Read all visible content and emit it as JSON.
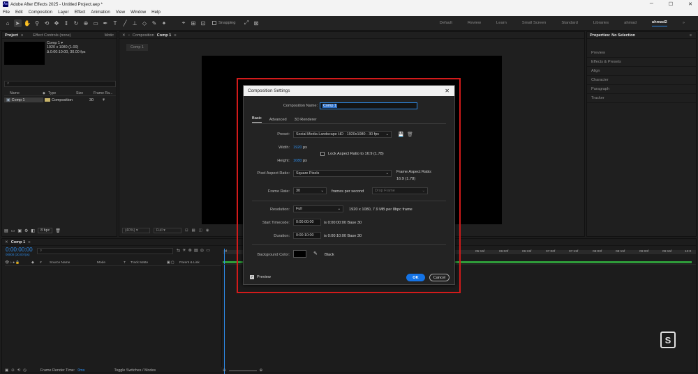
{
  "window": {
    "app_logo": "Ae",
    "title": "Adobe After Effects 2025 - Untitled Project.aep *",
    "controls": [
      "─",
      "☐",
      "✕"
    ]
  },
  "menu": [
    "File",
    "Edit",
    "Composition",
    "Layer",
    "Effect",
    "Animation",
    "View",
    "Window",
    "Help"
  ],
  "toolbar": {
    "snapping_label": "Snapping",
    "workspaces": [
      "Default",
      "Review",
      "Learn",
      "Small Screen",
      "Standard",
      "Libraries",
      "ahmad",
      "ahmad2"
    ],
    "active_workspace": "ahmad2",
    "more": "»"
  },
  "project_panel": {
    "tab_project": "Project",
    "tab_effect_controls": "Effect Controls (none)",
    "tab_more": "Motic",
    "comp_name": "Comp 1",
    "comp_dims": "1920 x 1080 (1.00)",
    "comp_duration": "Δ 0:00:10:00, 30.00 fps",
    "search_placeholder": "⌕",
    "columns": [
      "Name",
      "Type",
      "Size",
      "Frame Ra..."
    ],
    "items": [
      {
        "name": "Comp 1",
        "type": "Composition",
        "frame_rate": "30"
      }
    ],
    "bpc": "8 bpc"
  },
  "comp_viewer": {
    "tab_label": "Composition",
    "tab_name": "Comp 1",
    "sub_tab": "Comp 1",
    "zoom": "(40%)",
    "quality": "Full"
  },
  "right_panel": {
    "title": "Properties: No Selection",
    "items": [
      "Preview",
      "Effects & Presets",
      "Align",
      "Character",
      "Paragraph",
      "Tracker"
    ]
  },
  "timeline": {
    "tab_name": "Comp 1",
    "timecode": "0:00:00:00",
    "frame_sub": "00000 (30.00 fps)",
    "search_placeholder": "⌕",
    "columns": {
      "source": "Source Name",
      "mode": "Mode",
      "t": "T",
      "track_matte": "Track Matte",
      "parent": "Parent & Link"
    },
    "ruler": [
      "0f",
      "05:15f",
      "06:00f",
      "06:15f",
      "07:00f",
      "07:15f",
      "08:00f",
      "08:15f",
      "09:00f",
      "09:15f",
      "10:0"
    ],
    "frame_render_label": "Frame Render Time:",
    "frame_render_value": "0ms",
    "toggle_label": "Toggle Switches / Modes"
  },
  "dialog": {
    "title": "Composition Settings",
    "name_label": "Composition Name:",
    "name_value": "Comp 1",
    "tabs": [
      "Basic",
      "Advanced",
      "3D Renderer"
    ],
    "active_tab": "Basic",
    "preset_label": "Preset:",
    "preset_value": "Social Media Landscape HD  ·  1920x1080 - 30 fps",
    "width_label": "Width:",
    "width_value": "1920",
    "height_label": "Height:",
    "height_value": "1080",
    "px": "px",
    "lock_label": "Lock Aspect Ratio to 16:9 (1.78)",
    "par_label": "Pixel Aspect Ratio:",
    "par_value": "Square Pixels",
    "far_label": "Frame Aspect Ratio:",
    "far_value": "16:9 (1.78)",
    "fps_label": "Frame Rate:",
    "fps_value": "30",
    "fps_unit": "frames per second",
    "drop_frame": "Drop Frame",
    "res_label": "Resolution:",
    "res_value": "Full",
    "res_info": "1920 x 1080, 7.9 MB per 8bpc frame",
    "start_label": "Start Timecode:",
    "start_value": "0:00:00:00",
    "start_info": "is 0:00:00:00  Base 30",
    "duration_label": "Duration:",
    "duration_value": "0:00:10:00",
    "duration_info": "is 0:00:10:00  Base 30",
    "bg_label": "Background Color:",
    "bg_name": "Black",
    "preview_label": "Preview",
    "ok": "OK",
    "cancel": "Cancel"
  },
  "colors": {
    "accent": "#2d8ceb",
    "highlight_outline": "#d31b1b",
    "bg_swatch": "#000000"
  }
}
